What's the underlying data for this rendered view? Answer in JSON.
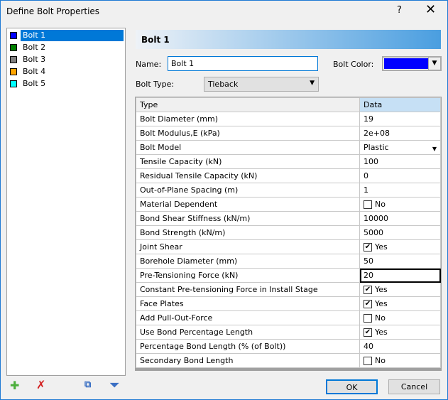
{
  "window": {
    "title": "Define Bolt Properties",
    "help": "?",
    "close": "✕"
  },
  "bolts": [
    {
      "label": "Bolt 1",
      "color": "#0000ff"
    },
    {
      "label": "Bolt 2",
      "color": "#008000"
    },
    {
      "label": "Bolt 3",
      "color": "#808080"
    },
    {
      "label": "Bolt 4",
      "color": "#ffa500"
    },
    {
      "label": "Bolt 5",
      "color": "#00ffff"
    }
  ],
  "header": "Bolt 1",
  "form": {
    "name_label": "Name:",
    "name_value": "Bolt 1",
    "color_label": "Bolt Color:",
    "color_value": "#0000ff",
    "type_label": "Bolt Type:",
    "type_value": "Tieback"
  },
  "grid": {
    "col_type": "Type",
    "col_data": "Data",
    "rows": [
      {
        "type": "Bolt Diameter (mm)",
        "value": "19"
      },
      {
        "type": "Bolt Modulus,E (kPa)",
        "value": "2e+08"
      },
      {
        "type": "Bolt Model",
        "value": "Plastic",
        "dropdown": true
      },
      {
        "type": "Tensile Capacity (kN)",
        "value": "100"
      },
      {
        "type": "Residual Tensile Capacity (kN)",
        "value": "0"
      },
      {
        "type": "Out-of-Plane Spacing (m)",
        "value": "1"
      },
      {
        "type": "Material Dependent",
        "value": "No",
        "checkbox": false
      },
      {
        "type": "Bond Shear Stiffness (kN/m)",
        "value": "10000"
      },
      {
        "type": "Bond Strength (kN/m)",
        "value": "5000"
      },
      {
        "type": "Joint Shear",
        "value": "Yes",
        "checkbox": true
      },
      {
        "type": "Borehole Diameter (mm)",
        "value": "50"
      },
      {
        "type": "Pre-Tensioning Force (kN)",
        "value": "20",
        "selected": true
      },
      {
        "type": "Constant Pre-tensioning Force in Install Stage",
        "value": "Yes",
        "checkbox": true
      },
      {
        "type": "Face Plates",
        "value": "Yes",
        "checkbox": true
      },
      {
        "type": "Add Pull-Out-Force",
        "value": "No",
        "checkbox": false
      },
      {
        "type": "Use Bond Percentage Length",
        "value": "Yes",
        "checkbox": true
      },
      {
        "type": "Percentage Bond Length (% (of Bolt))",
        "value": "40"
      },
      {
        "type": "Secondary Bond Length",
        "value": "No",
        "checkbox": false
      }
    ]
  },
  "buttons": {
    "ok": "OK",
    "cancel": "Cancel"
  }
}
